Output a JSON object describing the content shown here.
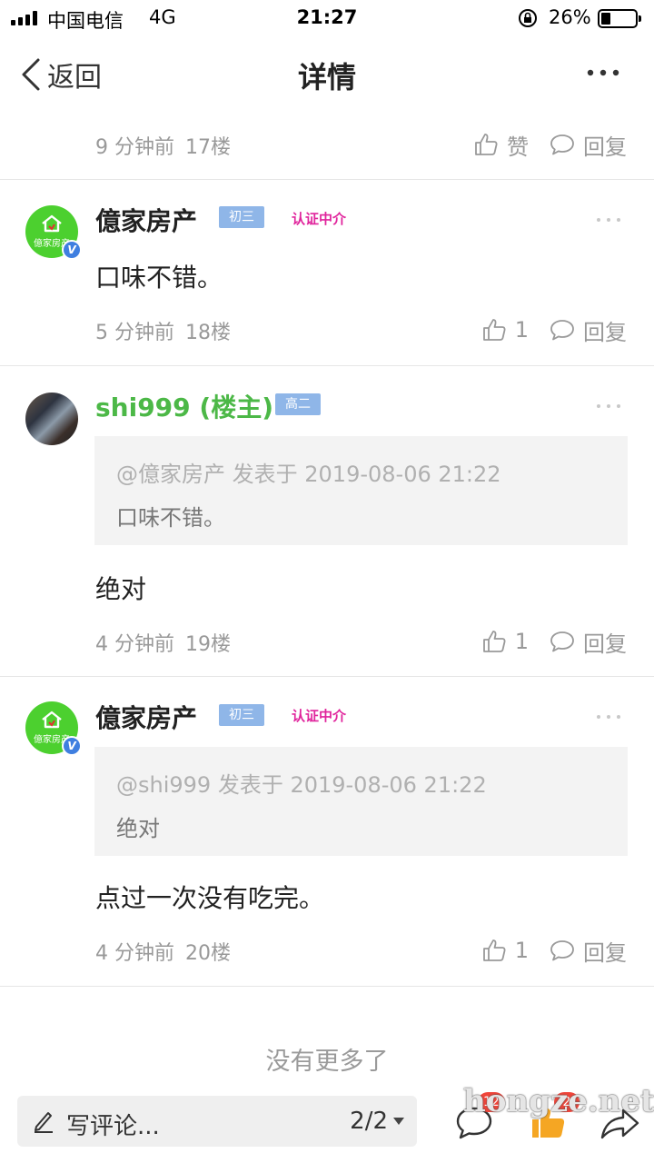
{
  "status_bar": {
    "carrier": "中国电信",
    "network": "4G",
    "time": "21:27",
    "battery": "26%"
  },
  "nav": {
    "back_label": "返回",
    "title": "详情"
  },
  "top_partial": {
    "time": "9 分钟前",
    "floor": "17楼",
    "like_label": "赞",
    "reply_label": "回复"
  },
  "posts": [
    {
      "user": "億家房产",
      "avatar_text": "億家房产",
      "level": "初三",
      "certification": "认证中介",
      "text": "口味不错。",
      "time": "5 分钟前",
      "floor": "18楼",
      "likes": "1",
      "reply_label": "回复"
    },
    {
      "user": "shi999 (楼主)",
      "level": "高二",
      "quote_meta": "@億家房产 发表于 2019-08-06 21:22",
      "quote_text": "口味不错。",
      "text": "绝对",
      "time": "4 分钟前",
      "floor": "19楼",
      "likes": "1",
      "reply_label": "回复"
    },
    {
      "user": "億家房产",
      "avatar_text": "億家房产",
      "level": "初三",
      "certification": "认证中介",
      "quote_meta": "@shi999 发表于 2019-08-06 21:22",
      "quote_text": "绝对",
      "text": "点过一次没有吃完。",
      "time": "4 分钟前",
      "floor": "20楼",
      "likes": "1",
      "reply_label": "回复"
    }
  ],
  "footer_note": "没有更多了",
  "bottom_bar": {
    "comment_placeholder": "写评论...",
    "page": "2/2",
    "comment_count": "12",
    "like_count": "2"
  },
  "watermark": "hongze.net",
  "colors": {
    "op_name": "#4cb847",
    "level_badge": "#8fb6e8",
    "certification": "#e0249c",
    "avatar_green": "#4cd02f",
    "badge_red": "#f0453a",
    "like_orange": "#f5a623"
  }
}
